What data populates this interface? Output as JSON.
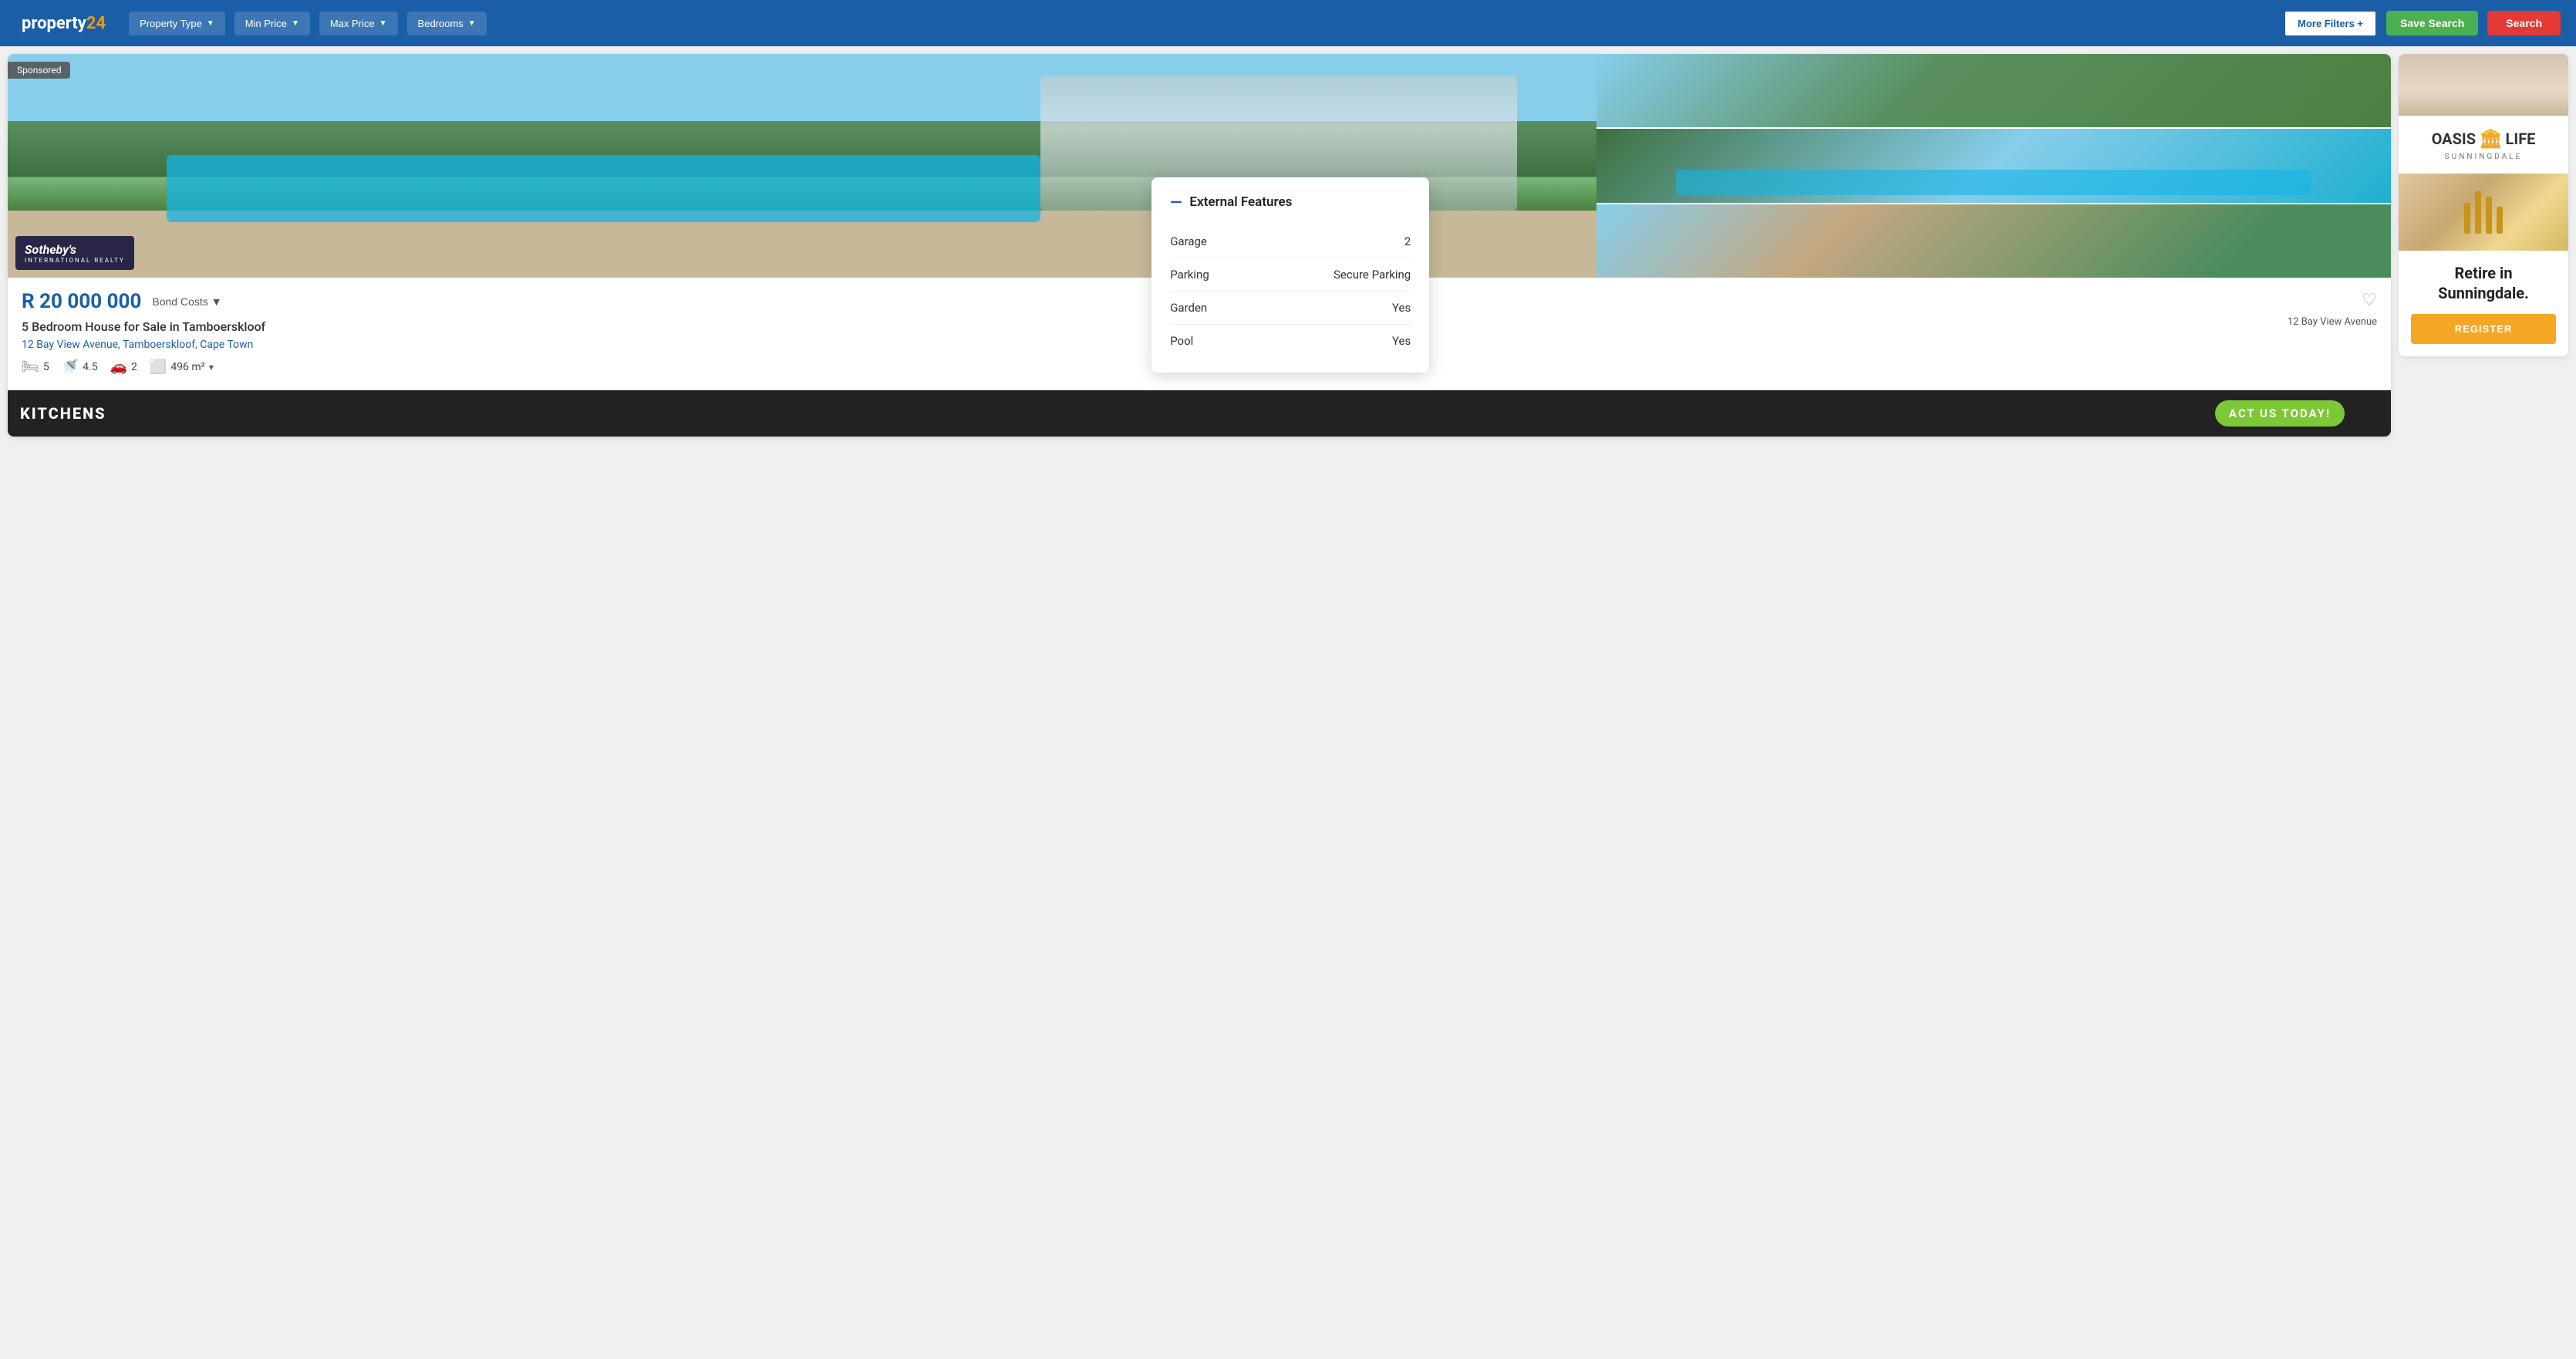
{
  "header": {
    "logo": "property24",
    "nav_items": [
      {
        "label": "Property Type",
        "id": "property-type"
      },
      {
        "label": "Min Price",
        "id": "min-price"
      },
      {
        "label": "Max Price",
        "id": "max-price"
      },
      {
        "label": "Bedrooms",
        "id": "bedrooms"
      }
    ],
    "more_filters": "More Filters +",
    "save_search": "Save Search",
    "search": "Search"
  },
  "property_card": {
    "sponsored": "Sponsored",
    "brand_name": "Sotheby's",
    "brand_sub": "INTERNATIONAL REALTY",
    "price": "R 20 000 000",
    "bond_costs": "Bond Costs",
    "address_short": "12 Bay View Avenue",
    "title": "5 Bedroom House for Sale in Tamboerskloof",
    "address_full": "12 Bay View Avenue, Tamboerskloof, Cape Town",
    "bedrooms": "5",
    "bathrooms": "4.5",
    "garages": "2",
    "floor_size": "496 m²"
  },
  "bottom_ad": {
    "text": "KITCHENS",
    "cta": "ACT US TODAY!"
  },
  "external_features": {
    "title": "External Features",
    "rows": [
      {
        "label": "Garage",
        "value": "2"
      },
      {
        "label": "Parking",
        "value": "Secure Parking"
      },
      {
        "label": "Garden",
        "value": "Yes"
      },
      {
        "label": "Pool",
        "value": "Yes"
      }
    ]
  },
  "right_ad": {
    "brand": "OASIS",
    "brand2": "LIFE",
    "sunningdale": "SUNNINGDALE",
    "retire_text": "Retire in Sunningdale.",
    "register_btn": "REGISTER"
  },
  "colors": {
    "primary": "#1a5ea8",
    "accent_green": "#4caf50",
    "accent_red": "#e53935",
    "bond_costs_color": "#555",
    "price_color": "#1a5ea8"
  }
}
